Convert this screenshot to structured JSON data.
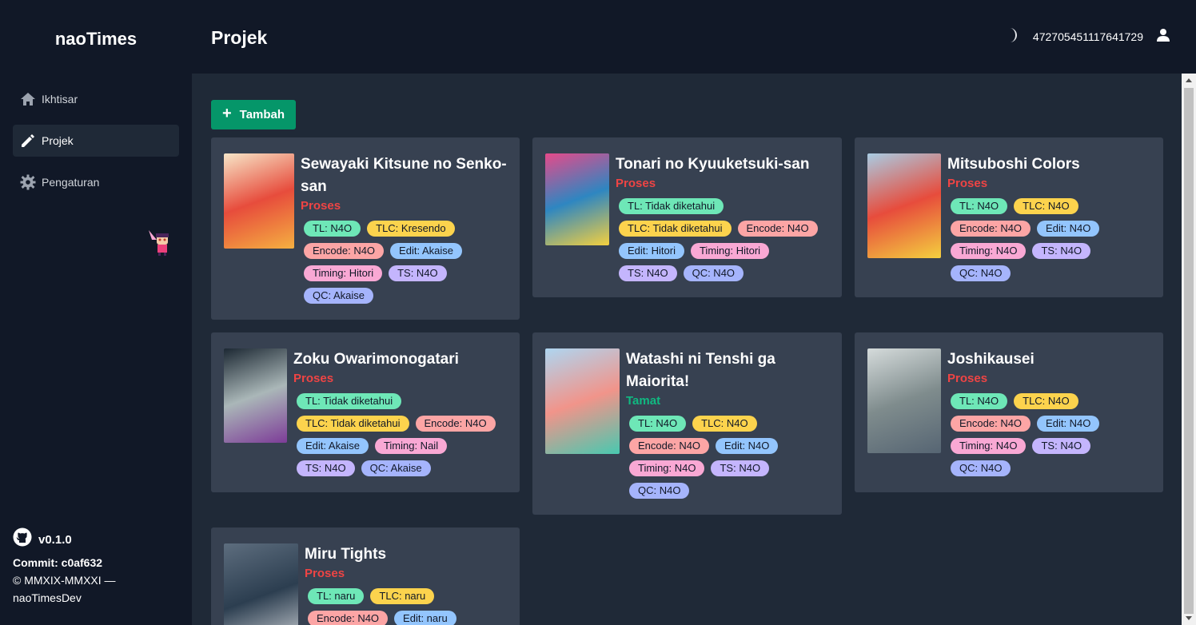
{
  "app": {
    "brand": "naoTimes"
  },
  "sidebar": {
    "items": [
      {
        "label": "Ikhtisar",
        "icon": "home-icon"
      },
      {
        "label": "Projek",
        "icon": "pencil-icon"
      },
      {
        "label": "Pengaturan",
        "icon": "gear-icon"
      }
    ],
    "footer": {
      "version": "v0.1.0",
      "commit": "Commit: c0af632",
      "copyright": "© MMXIX-MMXXI —",
      "author": "naoTimesDev"
    }
  },
  "header": {
    "title": "Projek",
    "user_id": "472705451117641729"
  },
  "main": {
    "add_label": "Tambah",
    "projects": [
      {
        "title": "Sewayaki Kitsune no Senko-san",
        "status": "Proses",
        "poster_colors": [
          "#f7e6c8",
          "#e74c3c",
          "#f5b041"
        ],
        "tags": [
          {
            "kind": "tl",
            "text": "TL: N4O"
          },
          {
            "kind": "tlc",
            "text": "TLC: Kresendo"
          },
          {
            "kind": "enc",
            "text": "Encode: N4O"
          },
          {
            "kind": "edit",
            "text": "Edit: Akaise"
          },
          {
            "kind": "timing",
            "text": "Timing: Hitori"
          },
          {
            "kind": "ts",
            "text": "TS: N4O"
          },
          {
            "kind": "qc",
            "text": "QC: Akaise"
          }
        ]
      },
      {
        "title": "Tonari no Kyuuketsuki-san",
        "status": "Proses",
        "poster_colors": [
          "#e64a8a",
          "#2e86c1",
          "#f4d03f"
        ],
        "tags": [
          {
            "kind": "tl",
            "text": "TL: Tidak diketahui"
          },
          {
            "kind": "tlc",
            "text": "TLC: Tidak diketahui"
          },
          {
            "kind": "enc",
            "text": "Encode: N4O"
          },
          {
            "kind": "edit",
            "text": "Edit: Hitori"
          },
          {
            "kind": "timing",
            "text": "Timing: Hitori"
          },
          {
            "kind": "ts",
            "text": "TS: N4O"
          },
          {
            "kind": "qc",
            "text": "QC: N4O"
          }
        ]
      },
      {
        "title": "Mitsuboshi Colors",
        "status": "Proses",
        "poster_colors": [
          "#a9cce3",
          "#e74c3c",
          "#f4d03f"
        ],
        "tags": [
          {
            "kind": "tl",
            "text": "TL: N4O"
          },
          {
            "kind": "tlc",
            "text": "TLC: N4O"
          },
          {
            "kind": "enc",
            "text": "Encode: N4O"
          },
          {
            "kind": "edit",
            "text": "Edit: N4O"
          },
          {
            "kind": "timing",
            "text": "Timing: N4O"
          },
          {
            "kind": "ts",
            "text": "TS: N4O"
          },
          {
            "kind": "qc",
            "text": "QC: N4O"
          }
        ]
      },
      {
        "title": "Zoku Owarimonogatari",
        "status": "Proses",
        "poster_colors": [
          "#1c2833",
          "#aab7b8",
          "#7d3c98"
        ],
        "tags": [
          {
            "kind": "tl",
            "text": "TL: Tidak diketahui"
          },
          {
            "kind": "tlc",
            "text": "TLC: Tidak diketahui"
          },
          {
            "kind": "enc",
            "text": "Encode: N4O"
          },
          {
            "kind": "edit",
            "text": "Edit: Akaise"
          },
          {
            "kind": "timing",
            "text": "Timing: Nail"
          },
          {
            "kind": "ts",
            "text": "TS: N4O"
          },
          {
            "kind": "qc",
            "text": "QC: Akaise"
          }
        ]
      },
      {
        "title": "Watashi ni Tenshi ga Maiorita!",
        "status": "Tamat",
        "poster_colors": [
          "#aed6f1",
          "#f1948a",
          "#48c9b0"
        ],
        "tags": [
          {
            "kind": "tl",
            "text": "TL: N4O"
          },
          {
            "kind": "tlc",
            "text": "TLC: N4O"
          },
          {
            "kind": "enc",
            "text": "Encode: N4O"
          },
          {
            "kind": "edit",
            "text": "Edit: N4O"
          },
          {
            "kind": "timing",
            "text": "Timing: N4O"
          },
          {
            "kind": "ts",
            "text": "TS: N4O"
          },
          {
            "kind": "qc",
            "text": "QC: N4O"
          }
        ]
      },
      {
        "title": "Joshikausei",
        "status": "Proses",
        "poster_colors": [
          "#d5dbdb",
          "#7f8c8d",
          "#566573"
        ],
        "tags": [
          {
            "kind": "tl",
            "text": "TL: N4O"
          },
          {
            "kind": "tlc",
            "text": "TLC: N4O"
          },
          {
            "kind": "enc",
            "text": "Encode: N4O"
          },
          {
            "kind": "edit",
            "text": "Edit: N4O"
          },
          {
            "kind": "timing",
            "text": "Timing: N4O"
          },
          {
            "kind": "ts",
            "text": "TS: N4O"
          },
          {
            "kind": "qc",
            "text": "QC: N4O"
          }
        ]
      },
      {
        "title": "Miru Tights",
        "status": "Proses",
        "poster_colors": [
          "#5d6d7e",
          "#2c3e50",
          "#d5d8dc"
        ],
        "tags": [
          {
            "kind": "tl",
            "text": "TL: naru"
          },
          {
            "kind": "tlc",
            "text": "TLC: naru"
          },
          {
            "kind": "enc",
            "text": "Encode: N4O"
          },
          {
            "kind": "edit",
            "text": "Edit: naru"
          }
        ]
      }
    ]
  }
}
